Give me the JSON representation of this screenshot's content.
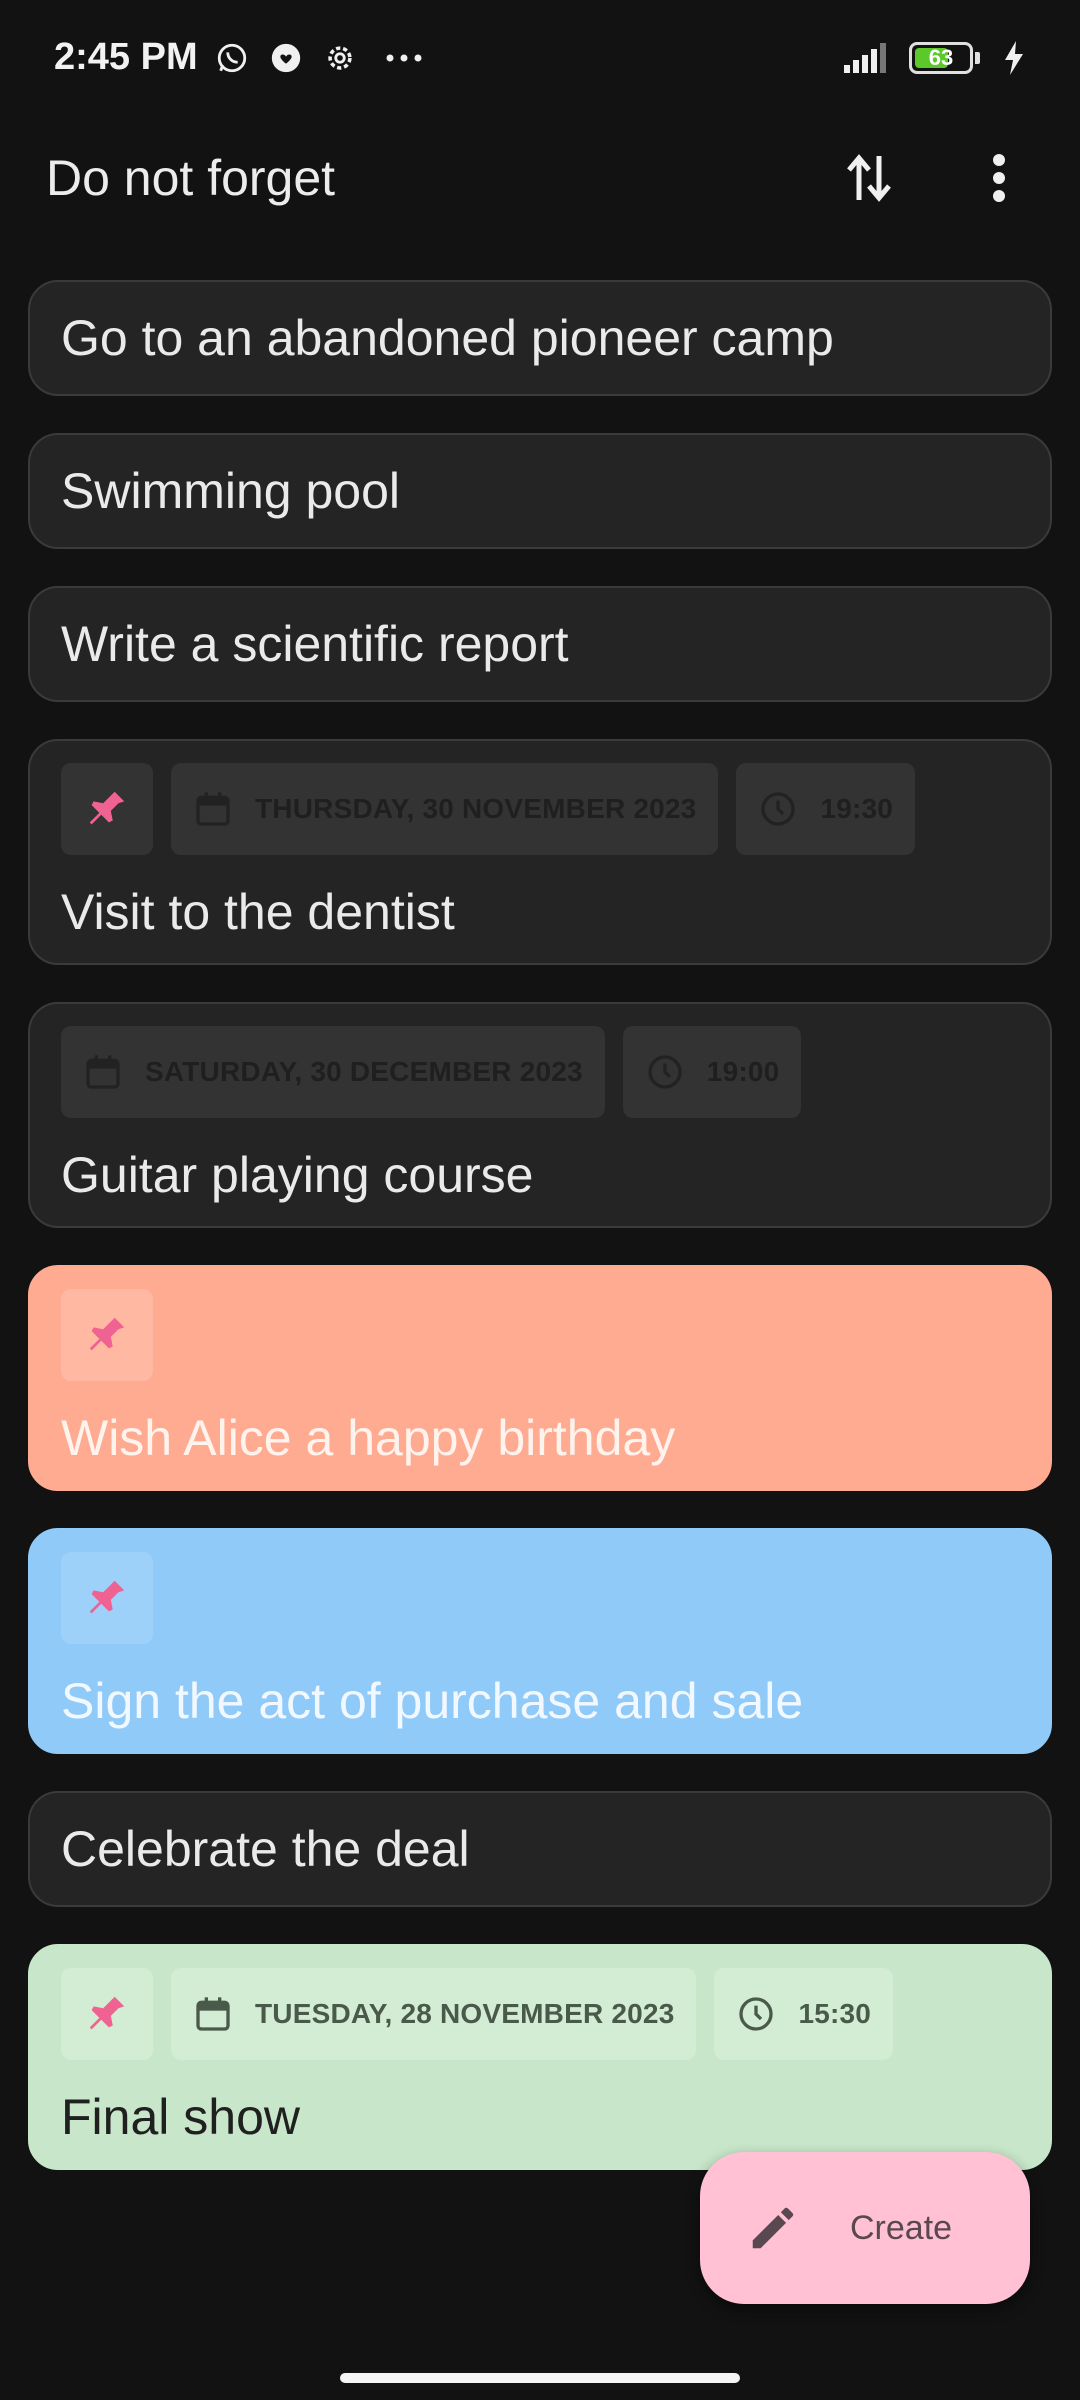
{
  "status_bar": {
    "time": "2:45 PM",
    "battery_level": "63",
    "battery_fraction": 0.63,
    "icons": [
      "whatsapp-icon",
      "messenger-icon",
      "settings-icon",
      "more-dots-icon",
      "signal-icon",
      "battery-icon",
      "charging-icon"
    ]
  },
  "app_bar": {
    "title": "Do not forget",
    "actions": [
      "sort-icon",
      "overflow-menu-icon"
    ]
  },
  "notes": [
    {
      "text": "Go to an abandoned pioneer camp"
    },
    {
      "text": "Swimming pool"
    },
    {
      "text": "Write a scientific report"
    },
    {
      "text": "Visit to the dentist",
      "pinned": true,
      "date": "THURSDAY, 30 NOVEMBER 2023",
      "time": "19:30"
    },
    {
      "text": "Guitar playing course",
      "pinned": false,
      "date": "SATURDAY, 30 DECEMBER 2023",
      "time": "19:00"
    },
    {
      "text": "Wish Alice a happy birthday",
      "pinned": true,
      "color": "#ffab91"
    },
    {
      "text": "Sign the act of purchase and sale",
      "pinned": true,
      "color": "#90caf9"
    },
    {
      "text": "Celebrate the deal"
    },
    {
      "text": "Final show",
      "pinned": true,
      "date": "TUESDAY, 28 NOVEMBER 2023",
      "time": "15:30",
      "color": "#c8e6c9"
    }
  ],
  "fab": {
    "label": "Create",
    "icon": "pencil-icon",
    "color": "#ffc1d3"
  },
  "colors": {
    "background": "#121212",
    "card": "#242424",
    "pin": "#f06292"
  }
}
